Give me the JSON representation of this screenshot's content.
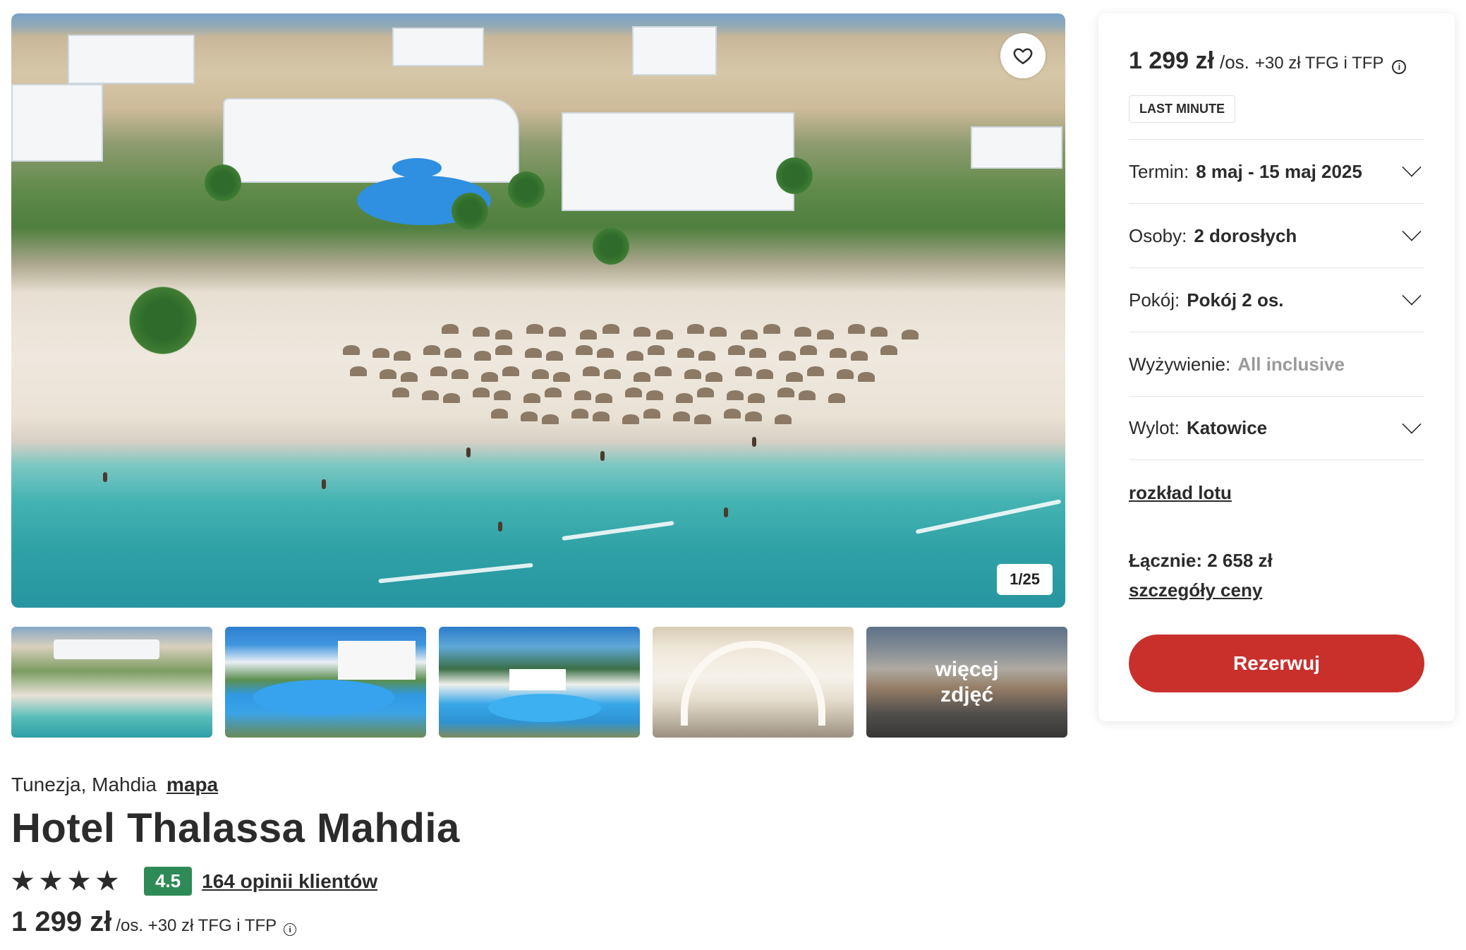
{
  "gallery": {
    "counter": "1/25",
    "more_photos_label": "więcej zdjęć",
    "main_photo_description": "aerial beach hotel",
    "thumbnails": [
      "beach-aerial",
      "pool-area",
      "pool-palms",
      "restaurant-interior",
      "terrace"
    ]
  },
  "hotel": {
    "location": "Tunezja, Mahdia",
    "map_link": "mapa",
    "name": "Hotel Thalassa Mahdia",
    "stars": 4,
    "score": "4.5",
    "reviews": "164 opinii klientów",
    "price_main": "1 299 zł",
    "price_suffix": "/os. +30 zł TFG i TFP"
  },
  "booking": {
    "price_main": "1 299 zł",
    "price_per": "/os.",
    "price_fee": "+30 zł TFG i TFP",
    "badge": "LAST MINUTE",
    "options": [
      {
        "label": "Termin:",
        "value": "8 maj - 15 maj 2025"
      },
      {
        "label": "Osoby:",
        "value": "2 dorosłych"
      },
      {
        "label": "Pokój:",
        "value": "Pokój 2 os."
      },
      {
        "label": "Wyżywienie:",
        "value": "All inclusive"
      },
      {
        "label": "Wylot:",
        "value": "Katowice"
      }
    ],
    "flight_schedule_link": "rozkład lotu",
    "total": "Łącznie: 2 658 zł",
    "price_details_link": "szczegóły ceny",
    "book_button": "Rezerwuj"
  },
  "colors": {
    "accent_red": "#c9302c",
    "score_green": "#2e8b57",
    "text_dark": "#2b2b2b"
  },
  "icons": {
    "favorite": "heart-icon",
    "info": "info-icon",
    "dropdown": "chevron-down-icon",
    "star": "star-icon"
  }
}
